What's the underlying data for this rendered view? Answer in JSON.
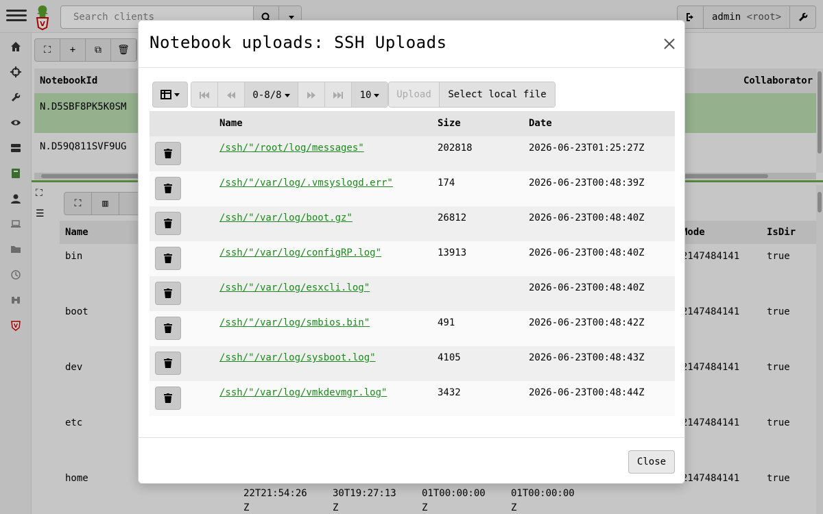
{
  "app": {
    "search": {
      "placeholder": "Search clients"
    },
    "user": {
      "name": "admin",
      "role": "<root>"
    },
    "notebooks_table": {
      "headers": {
        "id": "NotebookId",
        "collaborators": "Collaborator"
      },
      "rows": [
        "N.D5SBF8PK5K0SM",
        "N.D59Q811SVF9UG"
      ]
    },
    "files_table": {
      "headers": {
        "name": "Name",
        "mode": "Mode",
        "isdir": "IsDir"
      },
      "rows": [
        {
          "name": "bin",
          "mode": "2147484141",
          "isdir": "true"
        },
        {
          "name": "boot",
          "mode": "2147484141",
          "isdir": "true"
        },
        {
          "name": "dev",
          "mode": "2147484141",
          "isdir": "true"
        },
        {
          "name": "etc",
          "mode": "2147484141",
          "isdir": "true"
        },
        {
          "name": "home",
          "mode": "2147484141",
          "isdir": "true"
        }
      ],
      "bottom_stamps": [
        "22T21:54:26\nZ",
        "30T19:27:13\nZ",
        "01T00:00:00\nZ",
        "01T00:00:00\nZ"
      ]
    }
  },
  "modal": {
    "title": "Notebook uploads: SSH Uploads",
    "close_label": "Close",
    "toolbar": {
      "range": "0-8/8",
      "page_size": "10",
      "upload_label": "Upload",
      "select_file_label": "Select local file"
    },
    "table": {
      "headers": {
        "name": "Name",
        "size": "Size",
        "date": "Date"
      },
      "rows": [
        {
          "name": "/ssh/\"/root/log/messages\"",
          "size": "202818",
          "date": "2026-06-23T01:25:27Z"
        },
        {
          "name": "/ssh/\"/var/log/.vmsyslogd.err\"",
          "size": "174",
          "date": "2026-06-23T00:48:39Z"
        },
        {
          "name": "/ssh/\"/var/log/boot.gz\"",
          "size": "26812",
          "date": "2026-06-23T00:48:40Z"
        },
        {
          "name": "/ssh/\"/var/log/configRP.log\"",
          "size": "13913",
          "date": "2026-06-23T00:48:40Z"
        },
        {
          "name": "/ssh/\"/var/log/esxcli.log\"",
          "size": "",
          "date": "2026-06-23T00:48:40Z"
        },
        {
          "name": "/ssh/\"/var/log/smbios.bin\"",
          "size": "491",
          "date": "2026-06-23T00:48:42Z"
        },
        {
          "name": "/ssh/\"/var/log/sysboot.log\"",
          "size": "4105",
          "date": "2026-06-23T00:48:43Z"
        },
        {
          "name": "/ssh/\"/var/log/vmkdevmgr.log\"",
          "size": "3432",
          "date": "2026-06-23T00:48:44Z"
        }
      ]
    }
  },
  "colors": {
    "link": "#1a8a1a",
    "selected_row": "#b9ddb0",
    "accent": "#6aa84f"
  }
}
